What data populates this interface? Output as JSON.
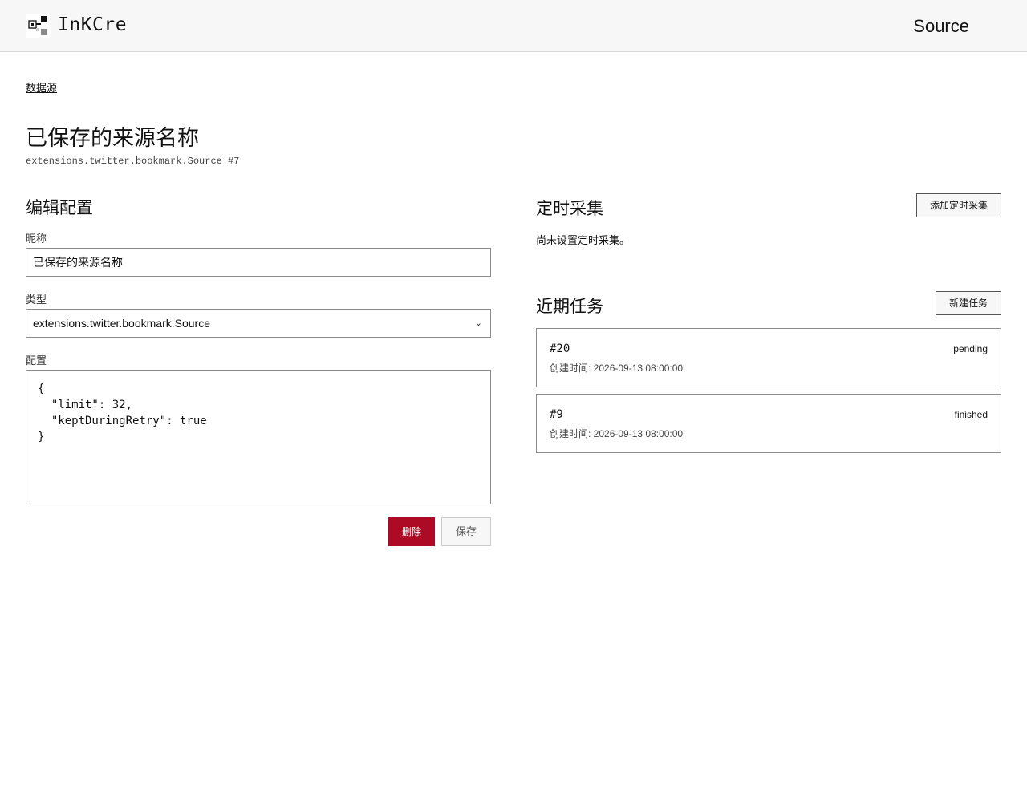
{
  "header": {
    "brand": "InKCre",
    "nav_source": "Source"
  },
  "breadcrumb": "数据源",
  "page": {
    "title": "已保存的来源名称",
    "subtitle": "extensions.twitter.bookmark.Source #7"
  },
  "edit": {
    "section_title": "编辑配置",
    "nickname_label": "昵称",
    "nickname_value": "已保存的来源名称",
    "type_label": "类型",
    "type_value": "extensions.twitter.bookmark.Source",
    "config_label": "配置",
    "config_value": "{\n  \"limit\": 32,\n  \"keptDuringRetry\": true\n}",
    "delete_label": "删除",
    "save_label": "保存"
  },
  "schedule": {
    "section_title": "定时采集",
    "add_label": "添加定时采集",
    "empty_text": "尚未设置定时采集。"
  },
  "tasks": {
    "section_title": "近期任务",
    "new_label": "新建任务",
    "items": [
      {
        "id": "#20",
        "status": "pending",
        "created": "创建时间: 2026-09-13 08:00:00"
      },
      {
        "id": "#9",
        "status": "finished",
        "created": "创建时间: 2026-09-13 08:00:00"
      }
    ]
  },
  "colors": {
    "danger": "#ad0a26",
    "header_bg": "#f7f7f7",
    "border": "#8c8c8c"
  }
}
